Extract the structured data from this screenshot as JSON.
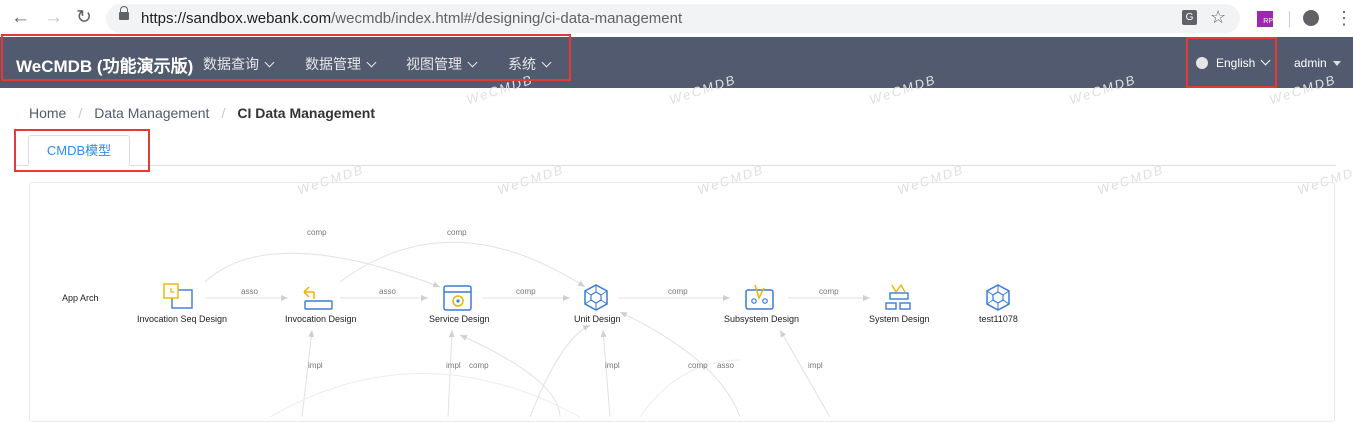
{
  "browser": {
    "url_host": "https://sandbox.webank.com",
    "url_path": "/wecmdb/index.html#/designing/ci-data-management",
    "translate_icon": "translate-icon",
    "extension_label": "RP"
  },
  "header": {
    "brand": "WeCMDB (功能演示版)",
    "menus": [
      {
        "label": "数据查询"
      },
      {
        "label": "数据管理"
      },
      {
        "label": "视图管理"
      },
      {
        "label": "系统"
      }
    ],
    "language": "English",
    "user": "admin"
  },
  "watermark": "WeCMDB",
  "breadcrumb": {
    "home": "Home",
    "section": "Data Management",
    "current": "CI Data Management"
  },
  "tabs": [
    {
      "label": "CMDB模型",
      "active": true
    }
  ],
  "graph": {
    "layer_label": "App Arch",
    "nodes": [
      {
        "id": "n1",
        "label": "Invocation Seq Design",
        "icon": "sequence-doc-icon",
        "color": "#f0b400"
      },
      {
        "id": "n2",
        "label": "Invocation Design",
        "icon": "invocation-arrow-icon",
        "color": "#f0b400"
      },
      {
        "id": "n3",
        "label": "Service Design",
        "icon": "service-window-icon",
        "color": "#3a7bd5"
      },
      {
        "id": "n4",
        "label": "Unit Design",
        "icon": "hexagon-unit-icon",
        "color": "#3a7bd5"
      },
      {
        "id": "n5",
        "label": "Subsystem Design",
        "icon": "subsystem-icon",
        "color": "#3a7bd5"
      },
      {
        "id": "n6",
        "label": "System Design",
        "icon": "system-tree-icon",
        "color": "#3a7bd5"
      },
      {
        "id": "n7",
        "label": "test11078",
        "icon": "hexagon-unit-icon",
        "color": "#3a7bd5"
      }
    ],
    "edge_labels": {
      "asso": "asso",
      "comp": "comp",
      "impl": "impl"
    }
  }
}
